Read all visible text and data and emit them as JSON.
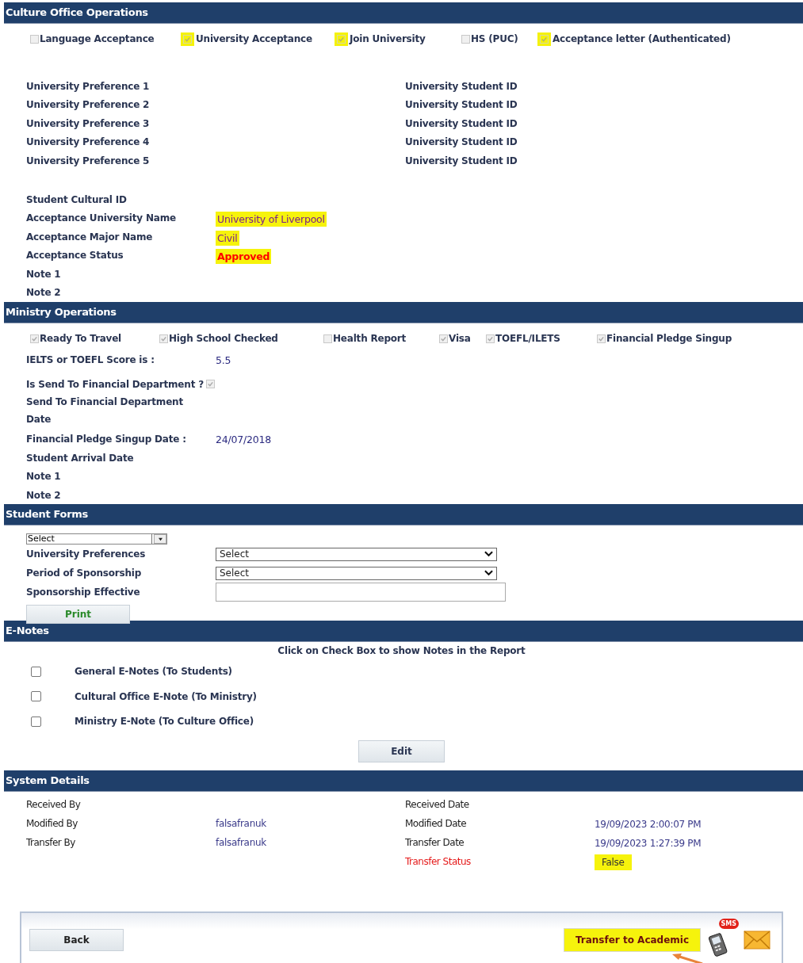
{
  "culture_office": {
    "title": "Culture Office Operations",
    "checks": [
      {
        "label": "Language Acceptance",
        "checked": false,
        "highlighted": false
      },
      {
        "label": "University Acceptance",
        "checked": true,
        "highlighted": true
      },
      {
        "label": "Join University",
        "checked": true,
        "highlighted": true
      },
      {
        "label": "HS (PUC)",
        "checked": false,
        "highlighted": false
      },
      {
        "label": "Acceptance letter (Authenticated)",
        "checked": true,
        "highlighted": true
      }
    ],
    "preferences": [
      {
        "label": "University Preference 1",
        "id_label": "University Student ID"
      },
      {
        "label": "University Preference 2",
        "id_label": "University Student ID"
      },
      {
        "label": "University Preference 3",
        "id_label": "University Student ID"
      },
      {
        "label": "University Preference 4",
        "id_label": "University Student ID"
      },
      {
        "label": "University Preference 5",
        "id_label": "University Student ID"
      }
    ],
    "fields": [
      {
        "label": "Student Cultural ID"
      },
      {
        "label": "Acceptance University Name",
        "kind": "text",
        "value": "University of Liverpool",
        "highlighted": true
      },
      {
        "label": "Acceptance Major Name",
        "kind": "text",
        "value": "Civil",
        "highlighted": true
      },
      {
        "label": "Acceptance Status",
        "kind": "status",
        "value": "Approved",
        "highlighted": true
      },
      {
        "label": "Note 1"
      },
      {
        "label": "Note 2"
      }
    ]
  },
  "ministry": {
    "title": "Ministry Operations",
    "checks": [
      {
        "label": "Ready To Travel",
        "checked": true
      },
      {
        "label": "High School Checked",
        "checked": true
      },
      {
        "label": "Health Report",
        "checked": false
      },
      {
        "label": "Visa",
        "checked": true
      },
      {
        "label": "TOEFL/ILETS",
        "checked": true
      },
      {
        "label": "Financial Pledge Singup",
        "checked": true
      }
    ],
    "fields": [
      {
        "kind": "text",
        "label": "IELTS or TOEFL Score is :",
        "value": "5.5"
      },
      {
        "kind": "check",
        "label": "Is Send To Financial Department ?",
        "checked": true
      },
      {
        "kind": "text",
        "label": "Send To Financial Department Date"
      },
      {
        "kind": "text",
        "label": "Financial Pledge Singup Date :",
        "value": "24/07/2018"
      },
      {
        "kind": "text",
        "label": "Student Arrival Date"
      },
      {
        "kind": "text",
        "label": "Note 1"
      },
      {
        "kind": "text",
        "label": "Note 2"
      }
    ]
  },
  "student_forms": {
    "title": "Student Forms",
    "form_select": {
      "value": "Select"
    },
    "fields": [
      {
        "kind": "select",
        "label": "University Preferences",
        "value": "Select"
      },
      {
        "kind": "select",
        "label": "Period of Sponsorship",
        "value": "Select"
      },
      {
        "kind": "input",
        "label": "Sponsorship Effective"
      }
    ],
    "print_button": "Print"
  },
  "e_notes": {
    "title": "E-Notes",
    "instruction": "Click on Check Box to show Notes in the Report",
    "notes": [
      {
        "label": "General E-Notes (To Students)",
        "checked": false
      },
      {
        "label": "Cultural Office E-Note (To Ministry)",
        "checked": false
      },
      {
        "label": "Ministry E-Note (To Culture Office)",
        "checked": false
      }
    ],
    "edit_button": "Edit"
  },
  "system_details": {
    "title": "System Details",
    "rows": [
      {
        "label": "Received By",
        "label_2": "Received Date"
      },
      {
        "label": "Modified By",
        "value": "falsafranuk",
        "label_2": "Modified Date",
        "value_2": "19/09/2023 2:00:07 PM"
      },
      {
        "label": "Transfer By",
        "value": "falsafranuk",
        "label_2": "Transfer Date",
        "value_2": "19/09/2023 1:27:39 PM"
      },
      {
        "label_2": "Transfer Status",
        "alert": true,
        "value_2": "False",
        "highlighted": true
      }
    ]
  },
  "footer": {
    "back_button": "Back",
    "transfer_button": {
      "label": "Transfer to Academic",
      "highlighted": true
    },
    "sms_badge": "SMS"
  }
}
